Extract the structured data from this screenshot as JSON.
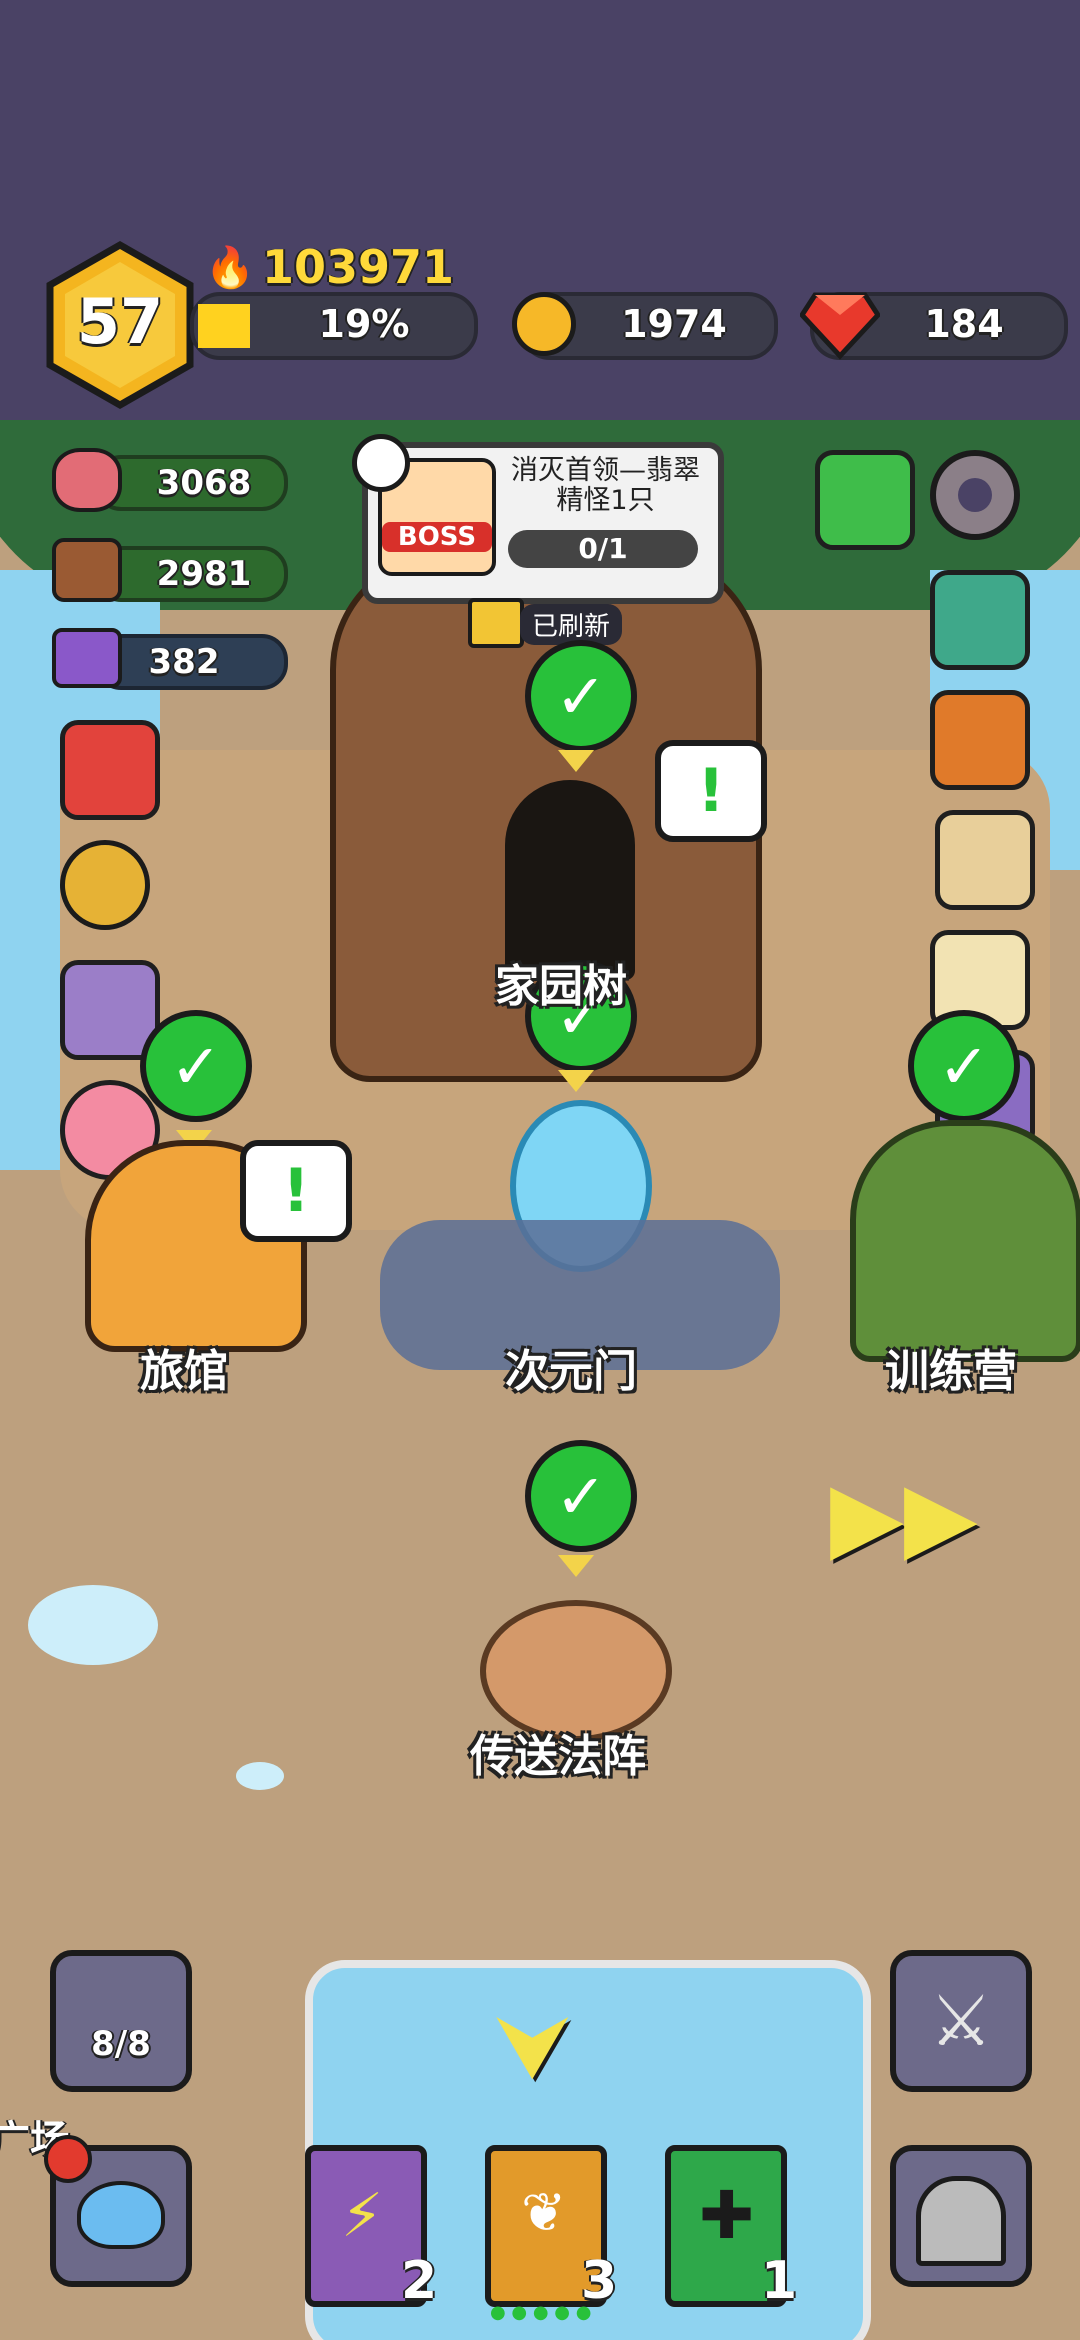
{
  "player": {
    "level": "57",
    "power": "103971",
    "exp_percent": "19%",
    "exp_fraction": 0.19
  },
  "currency": {
    "gold": "1974",
    "gems": "184"
  },
  "resources": {
    "meat": "3068",
    "wood": "2981",
    "ore": "382"
  },
  "quest": {
    "badge": "BOSS",
    "title": "消灭首领—翡翠精怪1只",
    "progress": "0/1"
  },
  "chest": {
    "label": "已刷新"
  },
  "buildings": {
    "tree": "家园树",
    "tavern": "旅馆",
    "portal": "次元门",
    "training": "训练营",
    "teleport": "传送法阵"
  },
  "bottom": {
    "slime_count": "8/8",
    "plaza_label": "广场",
    "books": [
      {
        "count": "2",
        "color": "#8a5bb5",
        "icon": "lightning-icon"
      },
      {
        "count": "3",
        "color": "#e29a2a",
        "icon": "wing-icon"
      },
      {
        "count": "1",
        "color": "#2ea84a",
        "icon": "cross-icon"
      }
    ]
  },
  "colors": {
    "top_bg": "#4a4265",
    "check_green": "#28c13a",
    "accent_yellow": "#f3d34a"
  }
}
